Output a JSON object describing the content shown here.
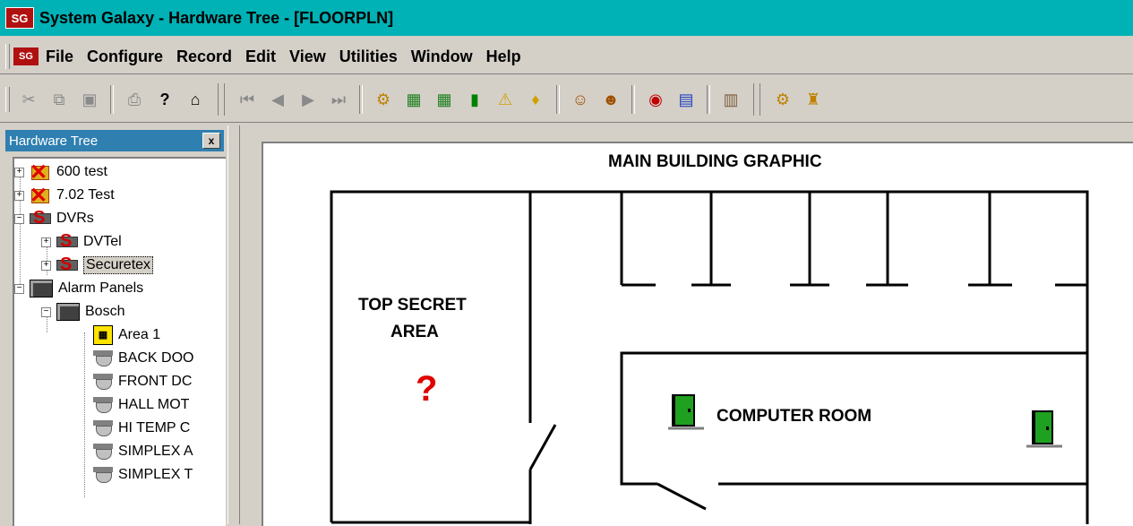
{
  "window": {
    "title": "System Galaxy - Hardware Tree - [FLOORPLN]",
    "app_icon_text": "SG"
  },
  "menu": {
    "icon_text": "SG",
    "items": [
      "File",
      "Configure",
      "Record",
      "Edit",
      "View",
      "Utilities",
      "Window",
      "Help"
    ]
  },
  "toolbar": {
    "groups": [
      [
        "cut-icon",
        "copy-icon",
        "paste-icon"
      ],
      [
        "print-icon",
        "help-icon",
        "clipboard-icon"
      ],
      [
        "first-record-icon",
        "prev-record-icon",
        "next-record-icon",
        "last-record-icon"
      ],
      [
        "hardware-tree-icon",
        "controller-icon",
        "controller2-icon",
        "door-icon",
        "alarm-icon",
        "idea-icon"
      ],
      [
        "user-icon",
        "users-icon"
      ],
      [
        "clock-icon",
        "grid-icon"
      ],
      [
        "floorplan-icon"
      ],
      [
        "network-icon",
        "system-icon"
      ]
    ]
  },
  "hardware_tree": {
    "title": "Hardware Tree",
    "close": "x",
    "items": [
      {
        "label": "600 test",
        "icon": "error-x-icon",
        "level": 0,
        "expander": "+"
      },
      {
        "label": "7.02 Test",
        "icon": "error-x-icon",
        "level": 0,
        "expander": "+"
      },
      {
        "label": "DVRs",
        "icon": "dvr-icon",
        "level": 0,
        "expander": "−"
      },
      {
        "label": "DVTel",
        "icon": "dvr-icon",
        "level": 1,
        "expander": "+"
      },
      {
        "label": "Securetex",
        "icon": "dvr-icon",
        "level": 1,
        "expander": "+",
        "selected": true
      },
      {
        "label": "Alarm Panels",
        "icon": "alarm-panel-icon",
        "level": 0,
        "expander": "−"
      },
      {
        "label": "Bosch",
        "icon": "alarm-panel-icon",
        "level": 1,
        "expander": "−"
      },
      {
        "label": "Area 1",
        "icon": "area-icon",
        "level": 2
      },
      {
        "label": "BACK DOO",
        "icon": "detector-icon",
        "level": 2
      },
      {
        "label": "FRONT DC",
        "icon": "detector-icon",
        "level": 2
      },
      {
        "label": "HALL MOT",
        "icon": "detector-icon",
        "level": 2
      },
      {
        "label": "HI TEMP C",
        "icon": "detector-icon",
        "level": 2
      },
      {
        "label": "SIMPLEX A",
        "icon": "detector-icon",
        "level": 2
      },
      {
        "label": "SIMPLEX T",
        "icon": "detector-icon",
        "level": 2
      }
    ]
  },
  "floorplan": {
    "title": "MAIN BUILDING GRAPHIC",
    "top_secret_line1": "TOP SECRET",
    "top_secret_line2": "AREA",
    "question_mark": "?",
    "computer_room": "COMPUTER ROOM"
  }
}
